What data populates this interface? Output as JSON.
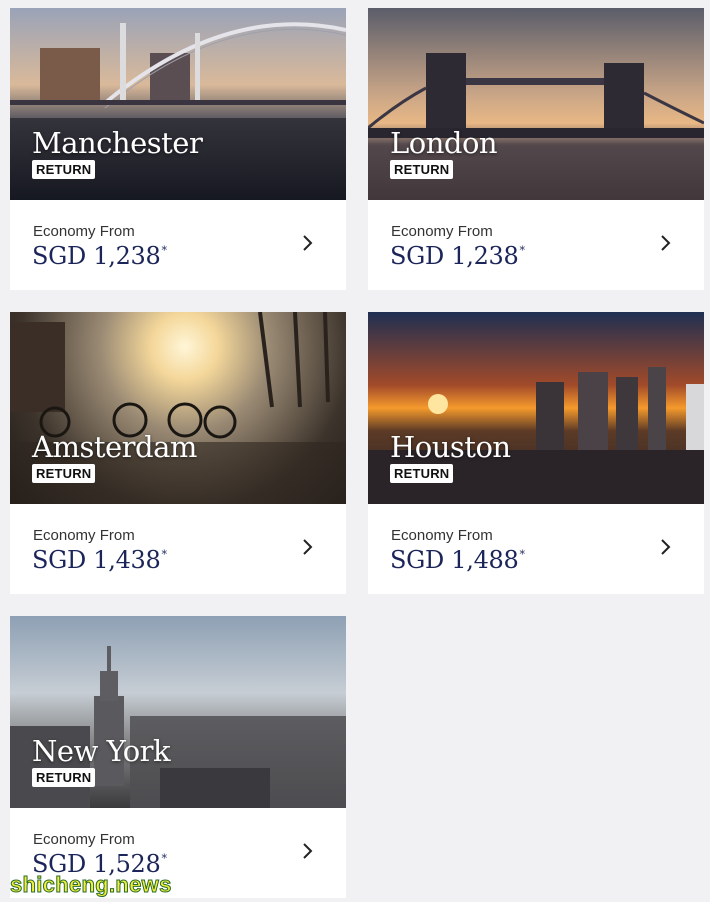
{
  "destinations": [
    {
      "city": "Manchester",
      "trip_type": "RETURN",
      "fare_label": "Economy From",
      "price": "SGD 1,238",
      "price_mark": "*"
    },
    {
      "city": "London",
      "trip_type": "RETURN",
      "fare_label": "Economy From",
      "price": "SGD 1,238",
      "price_mark": "*"
    },
    {
      "city": "Amsterdam",
      "trip_type": "RETURN",
      "fare_label": "Economy From",
      "price": "SGD 1,438",
      "price_mark": "*"
    },
    {
      "city": "Houston",
      "trip_type": "RETURN",
      "fare_label": "Economy From",
      "price": "SGD 1,488",
      "price_mark": "*"
    },
    {
      "city": "New York",
      "trip_type": "RETURN",
      "fare_label": "Economy From",
      "price": "SGD 1,528",
      "price_mark": "*"
    }
  ],
  "watermark": "shicheng.news",
  "colors": {
    "price": "#1b2559",
    "background": "#f1f1f3",
    "card": "#ffffff"
  },
  "icons": {
    "card_arrow": "chevron-right-icon"
  }
}
